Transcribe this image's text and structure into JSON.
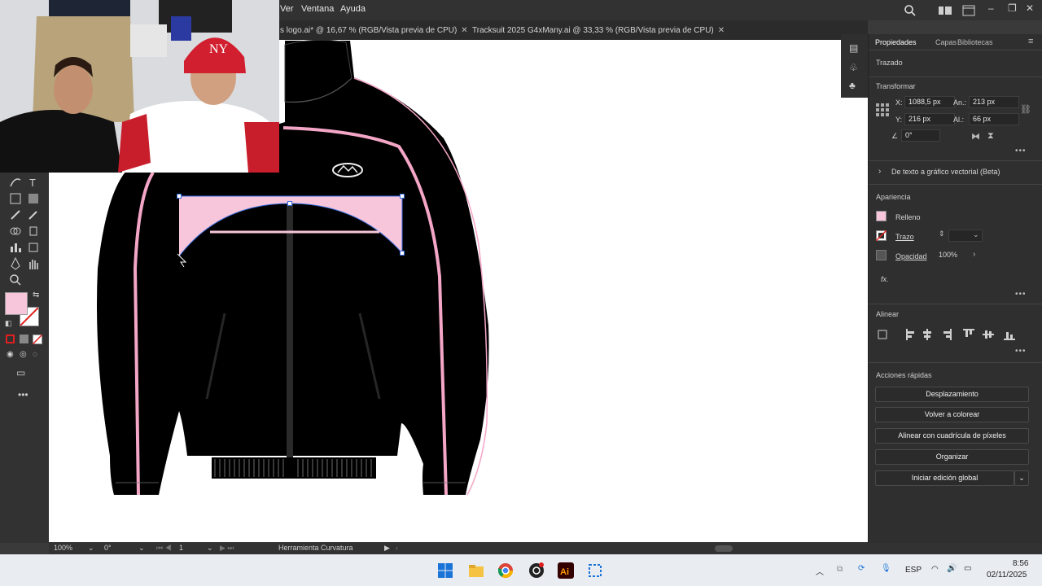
{
  "menubar": {
    "items": [
      "Ver",
      "Ventana",
      "Ayuda"
    ]
  },
  "doc_tabs": [
    {
      "label": "s logo.ai* @ 16,67 % (RGB/Vista previa de CPU)"
    },
    {
      "label": "Tracksuit 2025 G4xMany.ai @ 33,33 % (RGB/Vista previa de CPU)"
    }
  ],
  "panel": {
    "tabs": [
      "Propiedades",
      "Capas",
      "Bibliotecas"
    ],
    "object_type": "Trazado",
    "transform": {
      "title": "Transformar",
      "x_label": "X:",
      "x_value": "1088,5 px",
      "y_label": "Y:",
      "y_value": "216 px",
      "w_label": "An.:",
      "w_value": "213 px",
      "h_label": "Al.:",
      "h_value": "66 px",
      "angle_value": "0°"
    },
    "vector_beta": "De texto a gráfico vectorial (Beta)",
    "appearance": {
      "title": "Apariencia",
      "fill_label": "Relleno",
      "stroke_label": "Trazo",
      "opacity_label": "Opacidad",
      "opacity_value": "100%",
      "fx_label": "fx."
    },
    "align": {
      "title": "Alinear"
    },
    "quick_actions": {
      "title": "Acciones rápidas",
      "buttons": [
        "Desplazamiento",
        "Volver a colorear",
        "Alinear con cuadrícula de píxeles",
        "Organizar",
        "Iniciar edición global"
      ]
    }
  },
  "statusbar": {
    "zoom": "100%",
    "angle": "0°",
    "artboard": "1",
    "tool": "Herramienta Curvatura"
  },
  "taskbar": {
    "lang": "ESP",
    "time": "8:56",
    "date": "02/11/2025"
  },
  "colors": {
    "fill": "#f7c6da",
    "accent_pink": "#f4a6c6",
    "garment": "#000000",
    "panel_bg": "#2f2f2f"
  }
}
